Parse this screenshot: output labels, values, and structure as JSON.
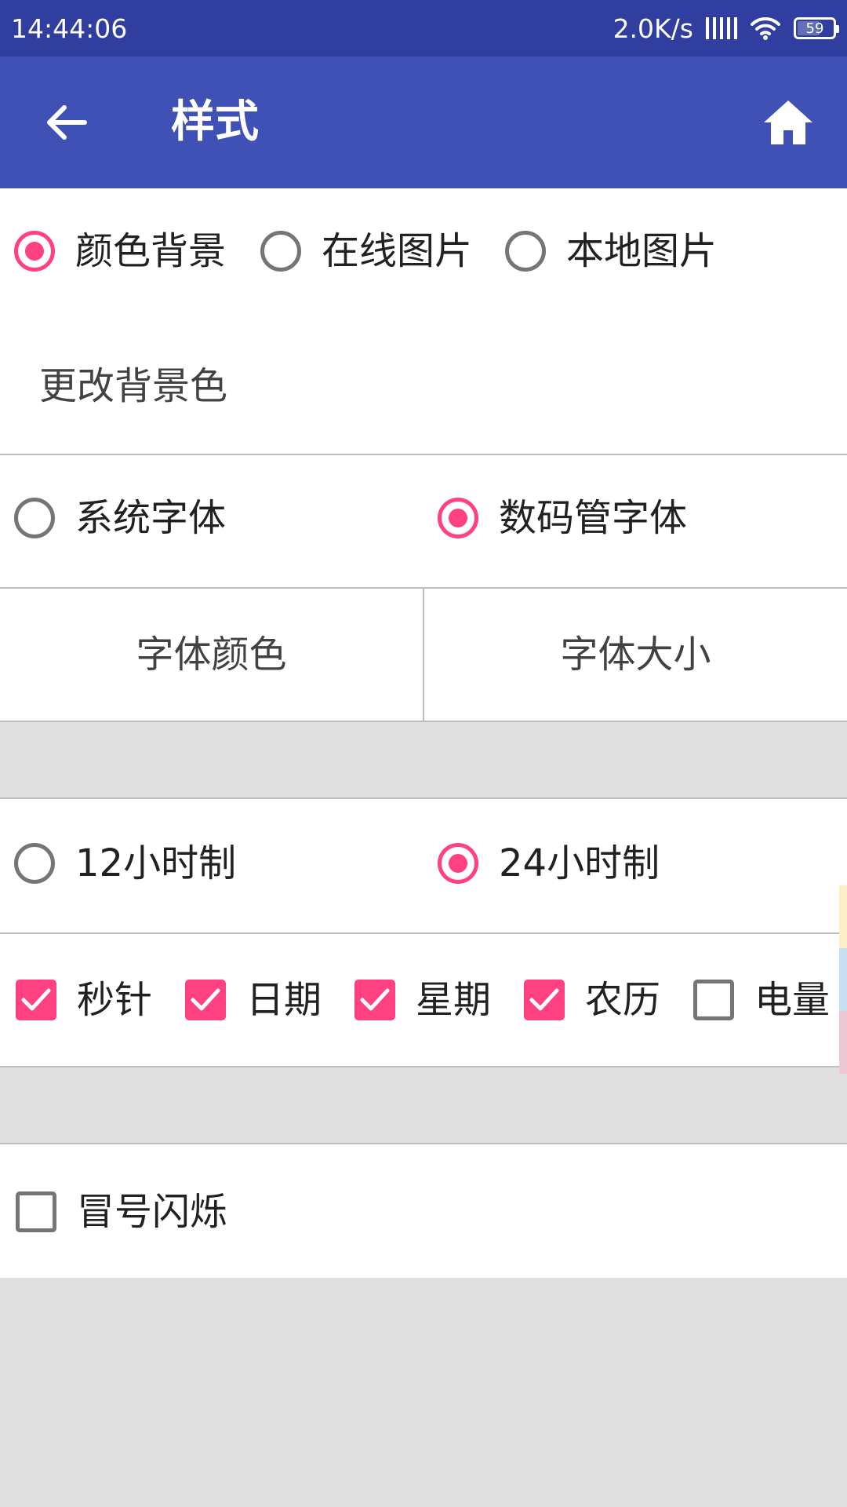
{
  "status_bar": {
    "time": "14:44:06",
    "speed": "2.0K/s",
    "battery": "59"
  },
  "app_bar": {
    "title": "样式",
    "back_icon": "arrow-back-icon",
    "home_icon": "home-icon"
  },
  "background": {
    "options": [
      {
        "label": "颜色背景",
        "selected": true
      },
      {
        "label": "在线图片",
        "selected": false
      },
      {
        "label": "本地图片",
        "selected": false
      }
    ],
    "change_bg_label": "更改背景色"
  },
  "font": {
    "options": [
      {
        "label": "系统字体",
        "selected": false
      },
      {
        "label": "数码管字体",
        "selected": true
      }
    ],
    "color_button": "字体颜色",
    "size_button": "字体大小"
  },
  "time_format": {
    "options": [
      {
        "label": "12小时制",
        "selected": false
      },
      {
        "label": "24小时制",
        "selected": true
      }
    ]
  },
  "display": {
    "checks": [
      {
        "label": "秒针",
        "checked": true
      },
      {
        "label": "日期",
        "checked": true
      },
      {
        "label": "星期",
        "checked": true
      },
      {
        "label": "农历",
        "checked": true
      },
      {
        "label": "电量",
        "checked": false
      }
    ]
  },
  "blink": {
    "label": "冒号闪烁",
    "checked": false
  },
  "colors": {
    "primary": "#3f51b5",
    "primary_dark": "#303f9f",
    "accent": "#ff4081",
    "background": "#e0e0e0"
  }
}
